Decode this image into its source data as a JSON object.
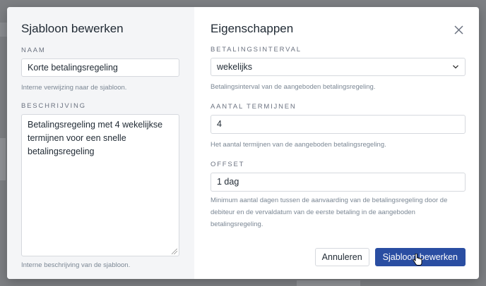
{
  "left": {
    "title": "Sjabloon bewerken",
    "name_label": "NAAM",
    "name_value": "Korte betalingsregeling",
    "name_hint": "Interne verwijzing naar de sjabloon.",
    "desc_label": "BESCHRIJVING",
    "desc_value": "Betalingsregeling met 4 wekelijkse termijnen voor een snelle betalingsregeling",
    "desc_hint": "Interne beschrijving van de sjabloon."
  },
  "right": {
    "title": "Eigenschappen",
    "interval_label": "BETALINGSINTERVAL",
    "interval_value": "wekelijks",
    "interval_hint": "Betalingsinterval van de aangeboden betalingsregeling.",
    "terms_label": "AANTAL TERMIJNEN",
    "terms_value": "4",
    "terms_hint": "Het aantal termijnen van de aangeboden betalingsregeling.",
    "offset_label": "OFFSET",
    "offset_value": "1 dag",
    "offset_hint": "Minimum aantal dagen tussen de aanvaarding van de betalingsregeling door de debiteur en de vervaldatum van de eerste betaling in de aangeboden betalingsregeling."
  },
  "buttons": {
    "cancel": "Annuleren",
    "submit": "Sjabloon bewerken"
  },
  "icons": {
    "close": "close-icon",
    "chevron": "chevron-down-icon",
    "cursor": "hand-pointer-cursor"
  },
  "colors": {
    "primary": "#2a4ea2",
    "left_panel_bg": "#f4f5f7",
    "overlay": "#7d7f83"
  }
}
